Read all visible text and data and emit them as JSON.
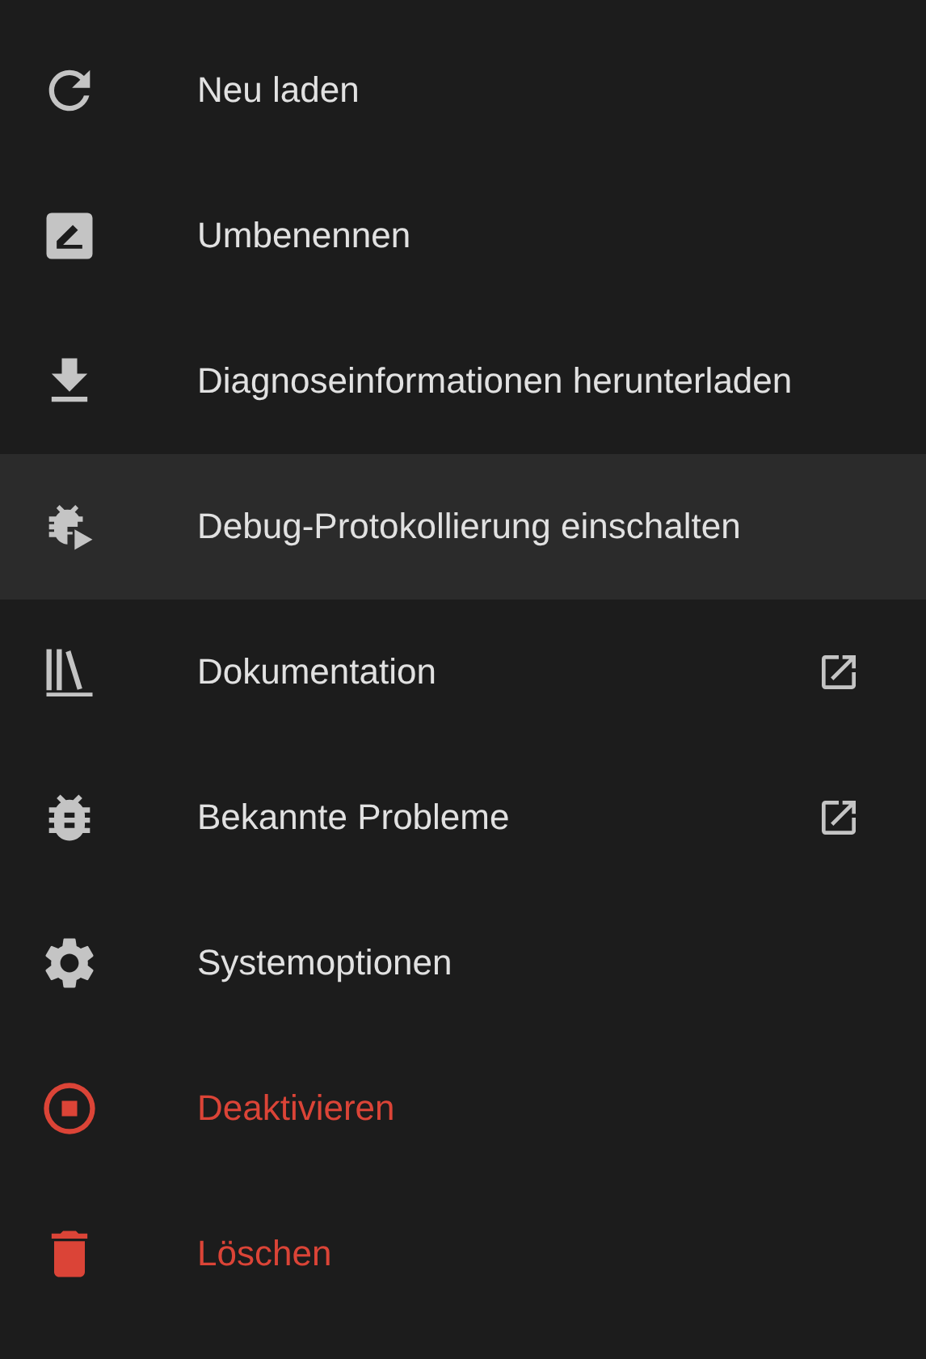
{
  "menu": {
    "items": [
      {
        "label": "Neu laden",
        "selected": false,
        "kind": "normal",
        "external": false
      },
      {
        "label": "Umbenennen",
        "selected": false,
        "kind": "normal",
        "external": false
      },
      {
        "label": "Diagnoseinformationen herunterladen",
        "selected": false,
        "kind": "normal",
        "external": false
      },
      {
        "label": "Debug-Protokollierung einschalten",
        "selected": true,
        "kind": "normal",
        "external": false
      },
      {
        "label": "Dokumentation",
        "selected": false,
        "kind": "normal",
        "external": true
      },
      {
        "label": "Bekannte Probleme",
        "selected": false,
        "kind": "normal",
        "external": true
      },
      {
        "label": "Systemoptionen",
        "selected": false,
        "kind": "normal",
        "external": false
      },
      {
        "label": "Deaktivieren",
        "selected": false,
        "kind": "danger",
        "external": false
      },
      {
        "label": "Löschen",
        "selected": false,
        "kind": "danger",
        "external": false
      }
    ]
  }
}
